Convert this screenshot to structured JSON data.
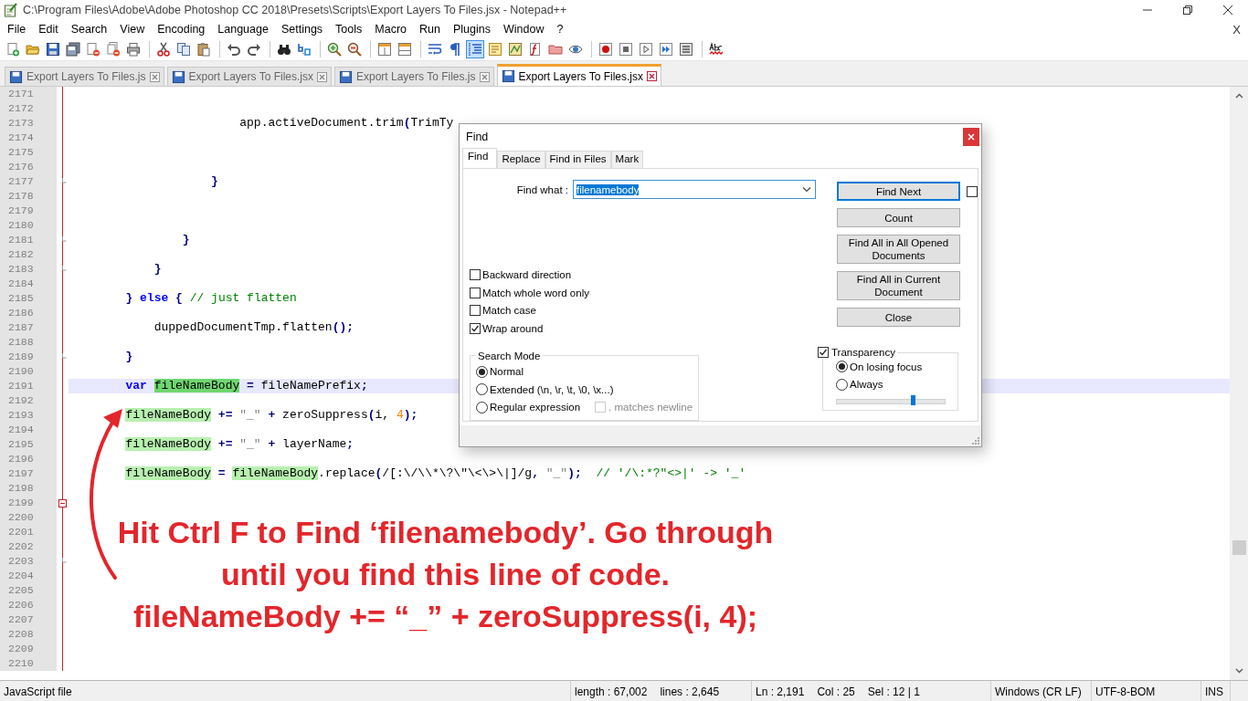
{
  "window": {
    "title": "C:\\Program Files\\Adobe\\Adobe Photoshop CC 2018\\Presets\\Scripts\\Export Layers To Files.jsx - Notepad++"
  },
  "menu": [
    "File",
    "Edit",
    "Search",
    "View",
    "Encoding",
    "Language",
    "Settings",
    "Tools",
    "Macro",
    "Run",
    "Plugins",
    "Window",
    "?"
  ],
  "menu_close": "X",
  "toolbar": [
    {
      "kind": "new",
      "selected": false
    },
    {
      "kind": "open",
      "selected": false
    },
    {
      "kind": "save",
      "selected": false
    },
    {
      "kind": "save-all",
      "selected": false
    },
    {
      "kind": "close",
      "selected": false
    },
    {
      "kind": "close-all",
      "selected": false
    },
    {
      "kind": "print",
      "selected": false
    },
    {
      "kind": "separator"
    },
    {
      "kind": "cut",
      "selected": false
    },
    {
      "kind": "copy",
      "selected": false
    },
    {
      "kind": "paste",
      "selected": false
    },
    {
      "kind": "separator"
    },
    {
      "kind": "undo",
      "selected": false
    },
    {
      "kind": "redo",
      "selected": false
    },
    {
      "kind": "separator"
    },
    {
      "kind": "find",
      "selected": false
    },
    {
      "kind": "replace",
      "selected": false
    },
    {
      "kind": "separator"
    },
    {
      "kind": "zoom-in",
      "selected": false
    },
    {
      "kind": "zoom-out",
      "selected": false
    },
    {
      "kind": "separator"
    },
    {
      "kind": "sync-vertical",
      "selected": false
    },
    {
      "kind": "sync-horizontal",
      "selected": false
    },
    {
      "kind": "separator"
    },
    {
      "kind": "word-wrap",
      "selected": false
    },
    {
      "kind": "all-chars",
      "selected": false
    },
    {
      "kind": "indent-guide",
      "selected": true
    },
    {
      "kind": "language",
      "selected": false
    },
    {
      "kind": "doc-map",
      "selected": false
    },
    {
      "kind": "function-list",
      "selected": false
    },
    {
      "kind": "folder",
      "selected": false
    },
    {
      "kind": "monitor",
      "selected": false
    },
    {
      "kind": "separator"
    },
    {
      "kind": "record",
      "selected": false
    },
    {
      "kind": "stop",
      "selected": false
    },
    {
      "kind": "play",
      "selected": false
    },
    {
      "kind": "play-multiple",
      "selected": false
    },
    {
      "kind": "save-macro",
      "selected": false
    },
    {
      "kind": "separator"
    },
    {
      "kind": "spellcheck",
      "selected": false
    }
  ],
  "tabs": [
    {
      "label": "Export Layers To Files.js",
      "selected": false
    },
    {
      "label": "Export Layers To Files.jsx",
      "selected": false
    },
    {
      "label": "Export Layers To Files.js",
      "selected": false
    },
    {
      "label": "Export Layers To Files.jsx",
      "selected": true
    }
  ],
  "editor": {
    "lines": [
      {
        "number": "2171",
        "kind": "plain",
        "current": false
      },
      {
        "number": "2172",
        "kind": "plain",
        "current": false
      },
      {
        "number": "2173",
        "kind": "plain",
        "current": false,
        "tokens": [
          {
            "text": "                        app.activeDocument.trim",
            "kind": "plain"
          },
          {
            "text": "(",
            "kind": "operator"
          },
          {
            "text": "TrimTy",
            "kind": "plain"
          }
        ]
      },
      {
        "number": "2174",
        "kind": "plain",
        "current": false
      },
      {
        "number": "2175",
        "kind": "plain",
        "current": false
      },
      {
        "number": "2176",
        "kind": "plain",
        "current": false
      },
      {
        "number": "2177",
        "kind": "fold-end",
        "current": false,
        "tokens": [
          {
            "text": "                    }",
            "kind": "operator"
          }
        ]
      },
      {
        "number": "2178",
        "kind": "plain",
        "current": false
      },
      {
        "number": "2179",
        "kind": "plain",
        "current": false
      },
      {
        "number": "2180",
        "kind": "plain",
        "current": false
      },
      {
        "number": "2181",
        "kind": "fold-end",
        "current": false,
        "tokens": [
          {
            "text": "                }",
            "kind": "operator"
          }
        ]
      },
      {
        "number": "2182",
        "kind": "plain",
        "current": false
      },
      {
        "number": "2183",
        "kind": "fold-end",
        "current": false,
        "tokens": [
          {
            "text": "            }",
            "kind": "operator"
          }
        ]
      },
      {
        "number": "2184",
        "kind": "plain",
        "current": false
      },
      {
        "number": "2185",
        "kind": "plain",
        "current": false,
        "tokens": [
          {
            "text": "        }",
            "kind": "operator"
          },
          {
            "text": " else ",
            "kind": "keyword"
          },
          {
            "text": "{",
            "kind": "operator"
          },
          {
            "text": " // just flatten",
            "kind": "comment"
          }
        ]
      },
      {
        "number": "2186",
        "kind": "plain",
        "current": false
      },
      {
        "number": "2187",
        "kind": "plain",
        "current": false,
        "tokens": [
          {
            "text": "            duppedDocumentTmp.flatten",
            "kind": "plain"
          },
          {
            "text": "();",
            "kind": "operator"
          }
        ]
      },
      {
        "number": "2188",
        "kind": "plain",
        "current": false
      },
      {
        "number": "2189",
        "kind": "fold-end",
        "current": false,
        "tokens": [
          {
            "text": "        }",
            "kind": "operator"
          }
        ]
      },
      {
        "number": "2190",
        "kind": "plain",
        "current": false
      },
      {
        "number": "2191",
        "kind": "plain",
        "current": true,
        "tokens": [
          {
            "text": "        var ",
            "kind": "keyword"
          },
          {
            "text": "fileNameBody",
            "kind": "current-match"
          },
          {
            "text": " = ",
            "kind": "operator"
          },
          {
            "text": "fileNamePrefix",
            "kind": "plain"
          },
          {
            "text": ";",
            "kind": "operator"
          }
        ]
      },
      {
        "number": "2192",
        "kind": "plain",
        "current": false
      },
      {
        "number": "2193",
        "kind": "plain",
        "current": false,
        "tokens": [
          {
            "text": "        fileNameBody",
            "kind": "match"
          },
          {
            "text": " += ",
            "kind": "operator"
          },
          {
            "text": "\"_\"",
            "kind": "string"
          },
          {
            "text": " + ",
            "kind": "operator"
          },
          {
            "text": "zeroSuppress",
            "kind": "plain"
          },
          {
            "text": "(",
            "kind": "operator"
          },
          {
            "text": "i, ",
            "kind": "plain"
          },
          {
            "text": "4",
            "kind": "number"
          },
          {
            "text": ");",
            "kind": "operator"
          }
        ]
      },
      {
        "number": "2194",
        "kind": "plain",
        "current": false
      },
      {
        "number": "2195",
        "kind": "plain",
        "current": false,
        "tokens": [
          {
            "text": "        fileNameBody",
            "kind": "match"
          },
          {
            "text": " += ",
            "kind": "operator"
          },
          {
            "text": "\"_\"",
            "kind": "string"
          },
          {
            "text": " + ",
            "kind": "operator"
          },
          {
            "text": "layerName",
            "kind": "plain"
          },
          {
            "text": ";",
            "kind": "operator"
          }
        ]
      },
      {
        "number": "2196",
        "kind": "plain",
        "current": false
      },
      {
        "number": "2197",
        "kind": "plain",
        "current": false,
        "tokens": [
          {
            "text": "        fileNameBody",
            "kind": "match"
          },
          {
            "text": " = ",
            "kind": "operator"
          },
          {
            "text": "fileNameBody",
            "kind": "match"
          },
          {
            "text": ".replace",
            "kind": "plain"
          },
          {
            "text": "(",
            "kind": "operator"
          },
          {
            "text": "/[:\\/\\\\*\\?\\\"\\<\\>\\|]/g",
            "kind": "plain"
          },
          {
            "text": ", ",
            "kind": "operator"
          },
          {
            "text": "\"_\"",
            "kind": "string"
          },
          {
            "text": ");",
            "kind": "operator"
          },
          {
            "text": "  // '/\\:*?\"<>|' -> '_'",
            "kind": "comment"
          }
        ]
      },
      {
        "number": "2198",
        "kind": "plain",
        "current": false
      },
      {
        "number": "2199",
        "kind": "fold-start",
        "current": false
      },
      {
        "number": "2200",
        "kind": "plain",
        "current": false
      },
      {
        "number": "2201",
        "kind": "plain",
        "current": false
      },
      {
        "number": "2202",
        "kind": "plain",
        "current": false
      },
      {
        "number": "2203",
        "kind": "fold-end",
        "current": false
      },
      {
        "number": "2204",
        "kind": "plain",
        "current": false
      },
      {
        "number": "2205",
        "kind": "plain",
        "current": false
      },
      {
        "number": "2206",
        "kind": "plain",
        "current": false
      },
      {
        "number": "2207",
        "kind": "plain",
        "current": false
      },
      {
        "number": "2208",
        "kind": "plain",
        "current": false
      },
      {
        "number": "2209",
        "kind": "plain",
        "current": false
      },
      {
        "number": "2210",
        "kind": "plain",
        "current": false
      }
    ]
  },
  "annotation": {
    "lines": [
      "Hit Ctrl F to Find ‘filenamebody’. Go through",
      "until you find this line of code.",
      "fileNameBody += “_” + zeroSuppress(i, 4);"
    ]
  },
  "find_dialog": {
    "title": "Find",
    "tabs": [
      {
        "label": "Find",
        "selected": true
      },
      {
        "label": "Replace",
        "selected": false
      },
      {
        "label": "Find in Files",
        "selected": false
      },
      {
        "label": "Mark",
        "selected": false
      }
    ],
    "find_what": {
      "label": "Find what :",
      "value": "filenamebody"
    },
    "options": [
      {
        "label": "Backward direction",
        "checked": false,
        "disabled": false
      },
      {
        "label": "Match whole word only",
        "checked": false,
        "disabled": false
      },
      {
        "label": "Match case",
        "checked": false,
        "disabled": false
      },
      {
        "label": "Wrap around",
        "checked": true,
        "disabled": false
      }
    ],
    "search_mode": {
      "title": "Search Mode",
      "modes": [
        {
          "label": "Normal",
          "selected": true
        },
        {
          "label": "Extended (\\n, \\r, \\t, \\0, \\x...)",
          "selected": false
        },
        {
          "label": "Regular expression",
          "selected": false
        }
      ],
      "dot_newline": {
        "label": ". matches newline",
        "checked": false,
        "disabled": true
      }
    },
    "buttons": [
      {
        "label": "Find Next",
        "default": true
      },
      {
        "label": "Count",
        "default": false
      },
      {
        "label": "Find All in All Opened Documents",
        "default": false
      },
      {
        "label": "Find All in Current Document",
        "default": false
      },
      {
        "label": "Close",
        "default": false
      }
    ],
    "find_next_checkbox": {
      "checked": false
    },
    "transparency": {
      "label": "Transparency",
      "checked": true,
      "modes": [
        {
          "label": "On losing focus",
          "selected": true
        },
        {
          "label": "Always",
          "selected": false
        }
      ],
      "level": 0.7
    }
  },
  "status_bar": [
    [
      "JavaScript file"
    ],
    [
      "length : 67,002",
      "lines : 2,645"
    ],
    [
      "Ln : 2,191",
      "Col : 25",
      "Sel : 12 | 1"
    ],
    [
      "Windows (CR LF)"
    ],
    [
      "UTF-8-BOM"
    ],
    [
      "INS"
    ]
  ]
}
